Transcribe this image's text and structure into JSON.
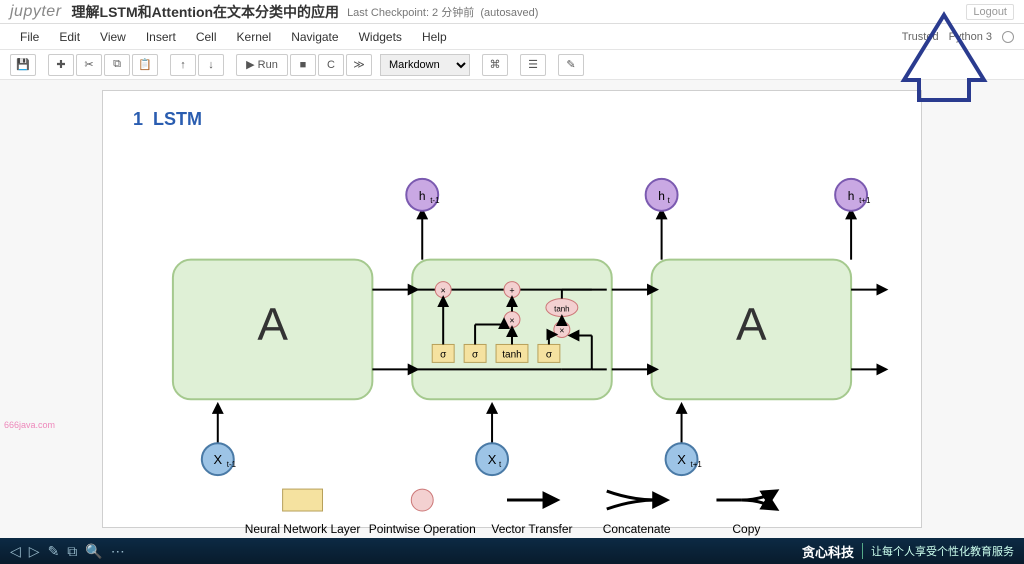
{
  "header": {
    "logo": "jupyter",
    "title": "理解LSTM和Attention在文本分类中的应用",
    "checkpoint": "Last Checkpoint: 2 分钟前",
    "autosaved": "(autosaved)",
    "logout": "Logout"
  },
  "menubar": {
    "items": [
      "File",
      "Edit",
      "View",
      "Insert",
      "Cell",
      "Kernel",
      "Navigate",
      "Widgets",
      "Help"
    ],
    "trusted": "Trusted",
    "kernel": "Python 3"
  },
  "toolbar": {
    "save_icon": "💾",
    "add": "✚",
    "cut": "✂",
    "copy": "⧉",
    "paste": "📋",
    "up": "↑",
    "down": "↓",
    "run": "▶ Run",
    "stop": "■",
    "restart": "C",
    "fastfwd": "≫",
    "celltype": "Markdown",
    "cmd": "⌘",
    "table": "☰",
    "edit": "✎"
  },
  "content": {
    "section_number": "1",
    "section_title": "LSTM",
    "diagram": {
      "outputs": [
        "h_{t-1}",
        "h_t",
        "h_{t+1}"
      ],
      "inputs": [
        "X_{t-1}",
        "X_t",
        "X_{t+1}"
      ],
      "box_labels": [
        "A",
        "A"
      ],
      "gates": [
        "σ",
        "σ",
        "tanh",
        "σ"
      ],
      "tanh_top": "tanh",
      "legend": [
        {
          "label": "Neural Network Layer",
          "kind": "rect"
        },
        {
          "label": "Pointwise Operation",
          "kind": "circle"
        },
        {
          "label": "Vector Transfer",
          "kind": "arrow"
        },
        {
          "label": "Concatenate",
          "kind": "merge"
        },
        {
          "label": "Copy",
          "kind": "split"
        }
      ]
    }
  },
  "footer": {
    "brand": "贪心科技",
    "slogan": "让每个人享受个性化教育服务"
  },
  "watermark": "666java.com"
}
